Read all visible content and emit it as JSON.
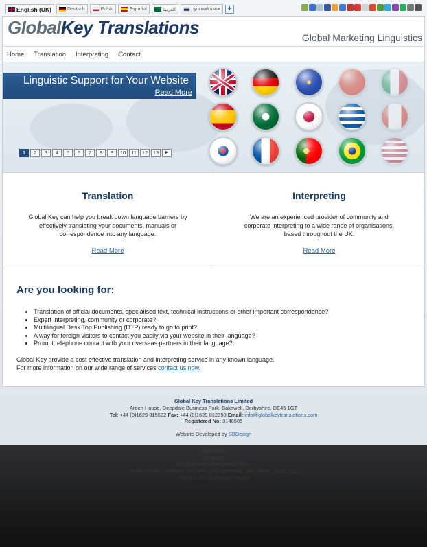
{
  "languages": [
    {
      "label": "English (UK)",
      "active": true
    },
    {
      "label": "Deutsch"
    },
    {
      "label": "Polski"
    },
    {
      "label": "Español"
    },
    {
      "label": "العربية"
    },
    {
      "label": "русский язык"
    }
  ],
  "lang_add_label": "+",
  "logo": {
    "part1": "Global",
    "part2": "Key Translations"
  },
  "tagline": "Global Marketing Linguistics",
  "nav": [
    "Home",
    "Translation",
    "Interpreting",
    "Contact"
  ],
  "hero": {
    "title": "Linguistic Support for Your Website",
    "read_more": "Read More"
  },
  "pager": [
    "1",
    "2",
    "3",
    "4",
    "5",
    "6",
    "7",
    "8",
    "9",
    "10",
    "11",
    "12",
    "13",
    "►"
  ],
  "columns": [
    {
      "title": "Translation",
      "text": "Global Key can help you break down language barriers by effectively translating your documents, manuals or correspondence into any language.",
      "link": "Read More"
    },
    {
      "title": "Interpreting",
      "text": "We are an experienced provider of community and corporate interpreting to a wide range of organisations, based throughout the UK.",
      "link": "Read More"
    }
  ],
  "looking": {
    "title": "Are you looking for:",
    "items": [
      "Translation of official documents, specialised text, technical instructions or other important correspondence?",
      "Expert interpreting, community or corporate?",
      "Multilingual Desk Top Publishing (DTP) ready to go to print?",
      "A way for foreign visitors to contact you easily via your website in their language?",
      "Prompt telephone contact with your overseas partners in their language?"
    ],
    "para1": "Global Key provide a cost effective translation and interpreting service in any known language.",
    "para2_prefix": "For more information on our wide range of services ",
    "para2_link": "contact us now",
    "para2_suffix": "."
  },
  "footer": {
    "company": "Global Key Translations Limited",
    "address": "Arden House, Deepdale Business Park, Bakewell, Derbyshire, DE45 1GT",
    "tel_label": "Tel:",
    "tel": "+44 (0)1629 815582",
    "fax_label": "Fax:",
    "fax": "+44 (0)1629 812850",
    "email_label": "Email:",
    "email": "info@globalkeytranslations.com",
    "reg_label": "Registered No:",
    "reg": "3146505",
    "dev_prefix": "Website Developed by ",
    "dev_link": "SBDesign"
  },
  "colors": {
    "brand_blue": "#1a3a66",
    "link_blue": "#2a66a4",
    "logo_grey": "#5f6d78"
  },
  "flag_icons": [
    "uk-flag",
    "germany-flag",
    "eu-flag",
    "china-flag",
    "italy-flag",
    "spain-flag",
    "saudi-flag",
    "japan-flag",
    "greece-flag",
    "canada-flag",
    "south-korea-flag",
    "france-flag",
    "portugal-flag",
    "brazil-flag",
    "usa-flag"
  ]
}
